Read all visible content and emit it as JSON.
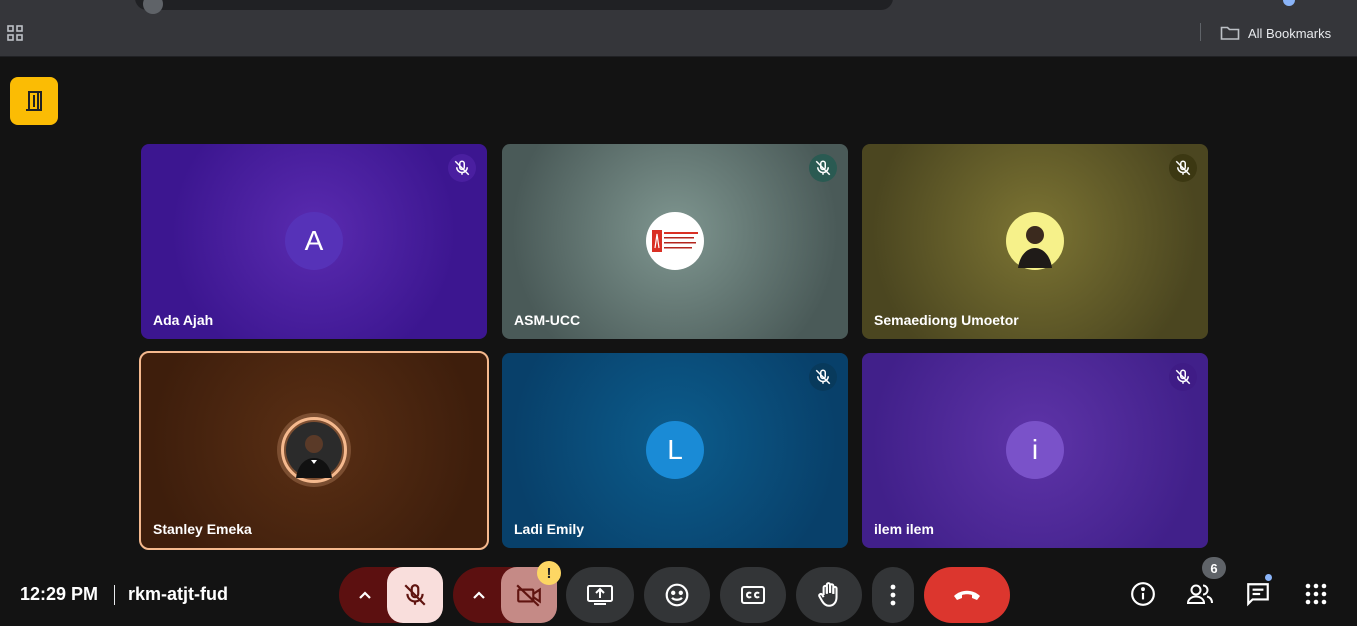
{
  "browser": {
    "bookmarks_label": "All Bookmarks"
  },
  "tiles": [
    {
      "name": "Ada Ajah",
      "avatar_letter": "A",
      "muted": true
    },
    {
      "name": "ASM-UCC",
      "avatar_letter": "",
      "muted": true,
      "logo_lines": [
        "AMERICAN SOCIETY",
        "FOR MICROBIOLOGY",
        "UNIVERSITY OF CAPE COAST"
      ]
    },
    {
      "name": "Semaediong Umoetor",
      "avatar_letter": "",
      "muted": true
    },
    {
      "name": "Stanley Emeka",
      "avatar_letter": "",
      "muted": false,
      "speaking": true
    },
    {
      "name": "Ladi Emily",
      "avatar_letter": "L",
      "muted": true
    },
    {
      "name": "ilem ilem",
      "avatar_letter": "i",
      "muted": true
    }
  ],
  "bottom_bar": {
    "time": "12:29 PM",
    "meeting_code": "rkm-atjt-fud",
    "camera_warning": "!",
    "participant_count": "6"
  },
  "colors": {
    "end_call": "#dc362e",
    "speaker_border": "#f5b98e",
    "activity_icon": "#fbbc04"
  }
}
